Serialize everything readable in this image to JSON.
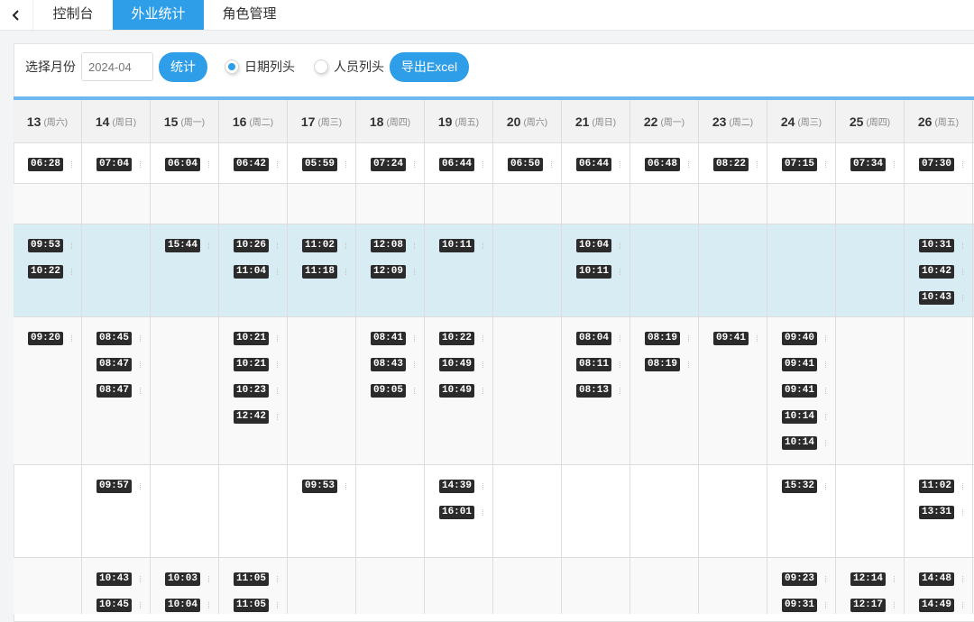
{
  "tabs": [
    {
      "label": "控制台",
      "active": false
    },
    {
      "label": "外业统计",
      "active": true
    },
    {
      "label": "角色管理",
      "active": false
    }
  ],
  "toolbar": {
    "month_label": "选择月份",
    "month_value": "2024-04",
    "stat_button": "统计",
    "radio_date": "日期列头",
    "radio_person": "人员列头",
    "selected_radio": "date",
    "export_button": "导出Excel"
  },
  "colors": {
    "accent": "#2e9ee9",
    "highlight_row": "#d8ecf4",
    "chip": "#2b2b2b"
  },
  "columns": [
    {
      "day": "13",
      "weekday": "(周六)"
    },
    {
      "day": "14",
      "weekday": "(周日)"
    },
    {
      "day": "15",
      "weekday": "(周一)"
    },
    {
      "day": "16",
      "weekday": "(周二)"
    },
    {
      "day": "17",
      "weekday": "(周三)"
    },
    {
      "day": "18",
      "weekday": "(周四)"
    },
    {
      "day": "19",
      "weekday": "(周五)"
    },
    {
      "day": "20",
      "weekday": "(周六)"
    },
    {
      "day": "21",
      "weekday": "(周日)"
    },
    {
      "day": "22",
      "weekday": "(周一)"
    },
    {
      "day": "23",
      "weekday": "(周二)"
    },
    {
      "day": "24",
      "weekday": "(周三)"
    },
    {
      "day": "25",
      "weekday": "(周四)"
    },
    {
      "day": "26",
      "weekday": "(周五)"
    }
  ],
  "rows": [
    {
      "style": "normal",
      "cells": [
        [
          "06:28"
        ],
        [
          "07:04"
        ],
        [
          "06:04"
        ],
        [
          "06:42"
        ],
        [
          "05:59"
        ],
        [
          "07:24"
        ],
        [
          "06:44"
        ],
        [
          "06:50"
        ],
        [
          "06:44"
        ],
        [
          "06:48"
        ],
        [
          "08:22"
        ],
        [
          "07:15"
        ],
        [
          "07:34"
        ],
        [
          "07:30"
        ]
      ]
    },
    {
      "style": "alt",
      "cells": [
        [],
        [],
        [],
        [],
        [],
        [],
        [],
        [],
        [],
        [],
        [],
        [],
        [],
        []
      ]
    },
    {
      "style": "highlight",
      "cells": [
        [
          "09:53",
          "10:22"
        ],
        [],
        [
          "15:44"
        ],
        [
          "10:26",
          "11:04"
        ],
        [
          "11:02",
          "11:18"
        ],
        [
          "12:08",
          "12:09"
        ],
        [
          "10:11"
        ],
        [],
        [
          "10:04",
          "10:11"
        ],
        [],
        [],
        [],
        [],
        [
          "10:31",
          "10:42",
          "10:43"
        ]
      ]
    },
    {
      "style": "alt",
      "cells": [
        [
          "09:20"
        ],
        [
          "08:45",
          "08:47",
          "08:47"
        ],
        [],
        [
          "10:21",
          "10:21",
          "10:23",
          "12:42"
        ],
        [],
        [
          "08:41",
          "08:43",
          "09:05"
        ],
        [
          "10:22",
          "10:49",
          "10:49"
        ],
        [],
        [
          "08:04",
          "08:11",
          "08:13"
        ],
        [
          "08:19",
          "08:19"
        ],
        [
          "09:41"
        ],
        [
          "09:40",
          "09:41",
          "09:41",
          "10:14",
          "10:14"
        ],
        [],
        []
      ]
    },
    {
      "style": "normal",
      "cells": [
        [],
        [
          "09:57"
        ],
        [],
        [],
        [
          "09:53"
        ],
        [],
        [
          "14:39",
          "16:01"
        ],
        [],
        [],
        [],
        [],
        [
          "15:32"
        ],
        [],
        [
          "11:02",
          "13:31"
        ]
      ]
    },
    {
      "style": "alt",
      "cells": [
        [],
        [
          "10:43",
          "10:45"
        ],
        [
          "10:03",
          "10:04"
        ],
        [
          "11:05",
          "11:05"
        ],
        [],
        [],
        [],
        [],
        [],
        [],
        [],
        [
          "09:23",
          "09:31"
        ],
        [
          "12:14",
          "12:17"
        ],
        [
          "14:48",
          "14:49"
        ]
      ]
    }
  ]
}
